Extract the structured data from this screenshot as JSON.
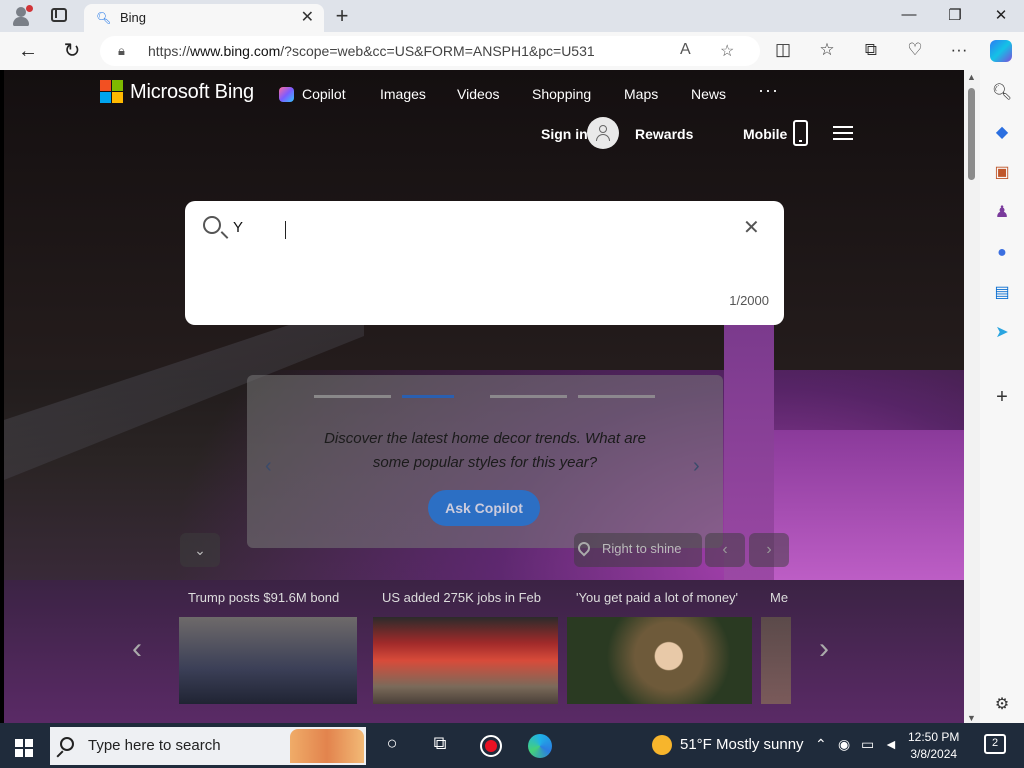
{
  "browser": {
    "tab_title": "Bing",
    "tab_favicon": "search-icon",
    "url_prefix": "https://",
    "url_host": "www.bing.com",
    "url_path": "/?scope=web&cc=US&FORM=ANSPH1&pc=U531"
  },
  "bing": {
    "logo_text": "Microsoft Bing",
    "nav": [
      "Copilot",
      "Images",
      "Videos",
      "Shopping",
      "Maps",
      "News"
    ],
    "more": "···",
    "sign_in": "Sign in",
    "rewards": "Rewards",
    "mobile": "Mobile",
    "search": {
      "value": "Y",
      "counter": "1/2000"
    },
    "copilot_card": {
      "question": "Discover the latest home decor trends. What are some popular styles for this year?",
      "button": "Ask Copilot",
      "active_step": 2
    },
    "image_caption": "Right to shine",
    "news": [
      {
        "title": "Trump posts $91.6M bond"
      },
      {
        "title": "US added 275K jobs in Feb"
      },
      {
        "title": "'You get paid a lot of money'"
      },
      {
        "title": "Me"
      }
    ]
  },
  "colors": {
    "accent": "#2c6fc4",
    "logo_red": "#f25022",
    "logo_green": "#7fba00",
    "logo_blue": "#00a4ef",
    "logo_yellow": "#ffb900"
  },
  "taskbar": {
    "search_placeholder": "Type here to search",
    "weather": "51°F  Mostly sunny",
    "time": "12:50 PM",
    "date": "3/8/2024",
    "notification_count": "2"
  }
}
